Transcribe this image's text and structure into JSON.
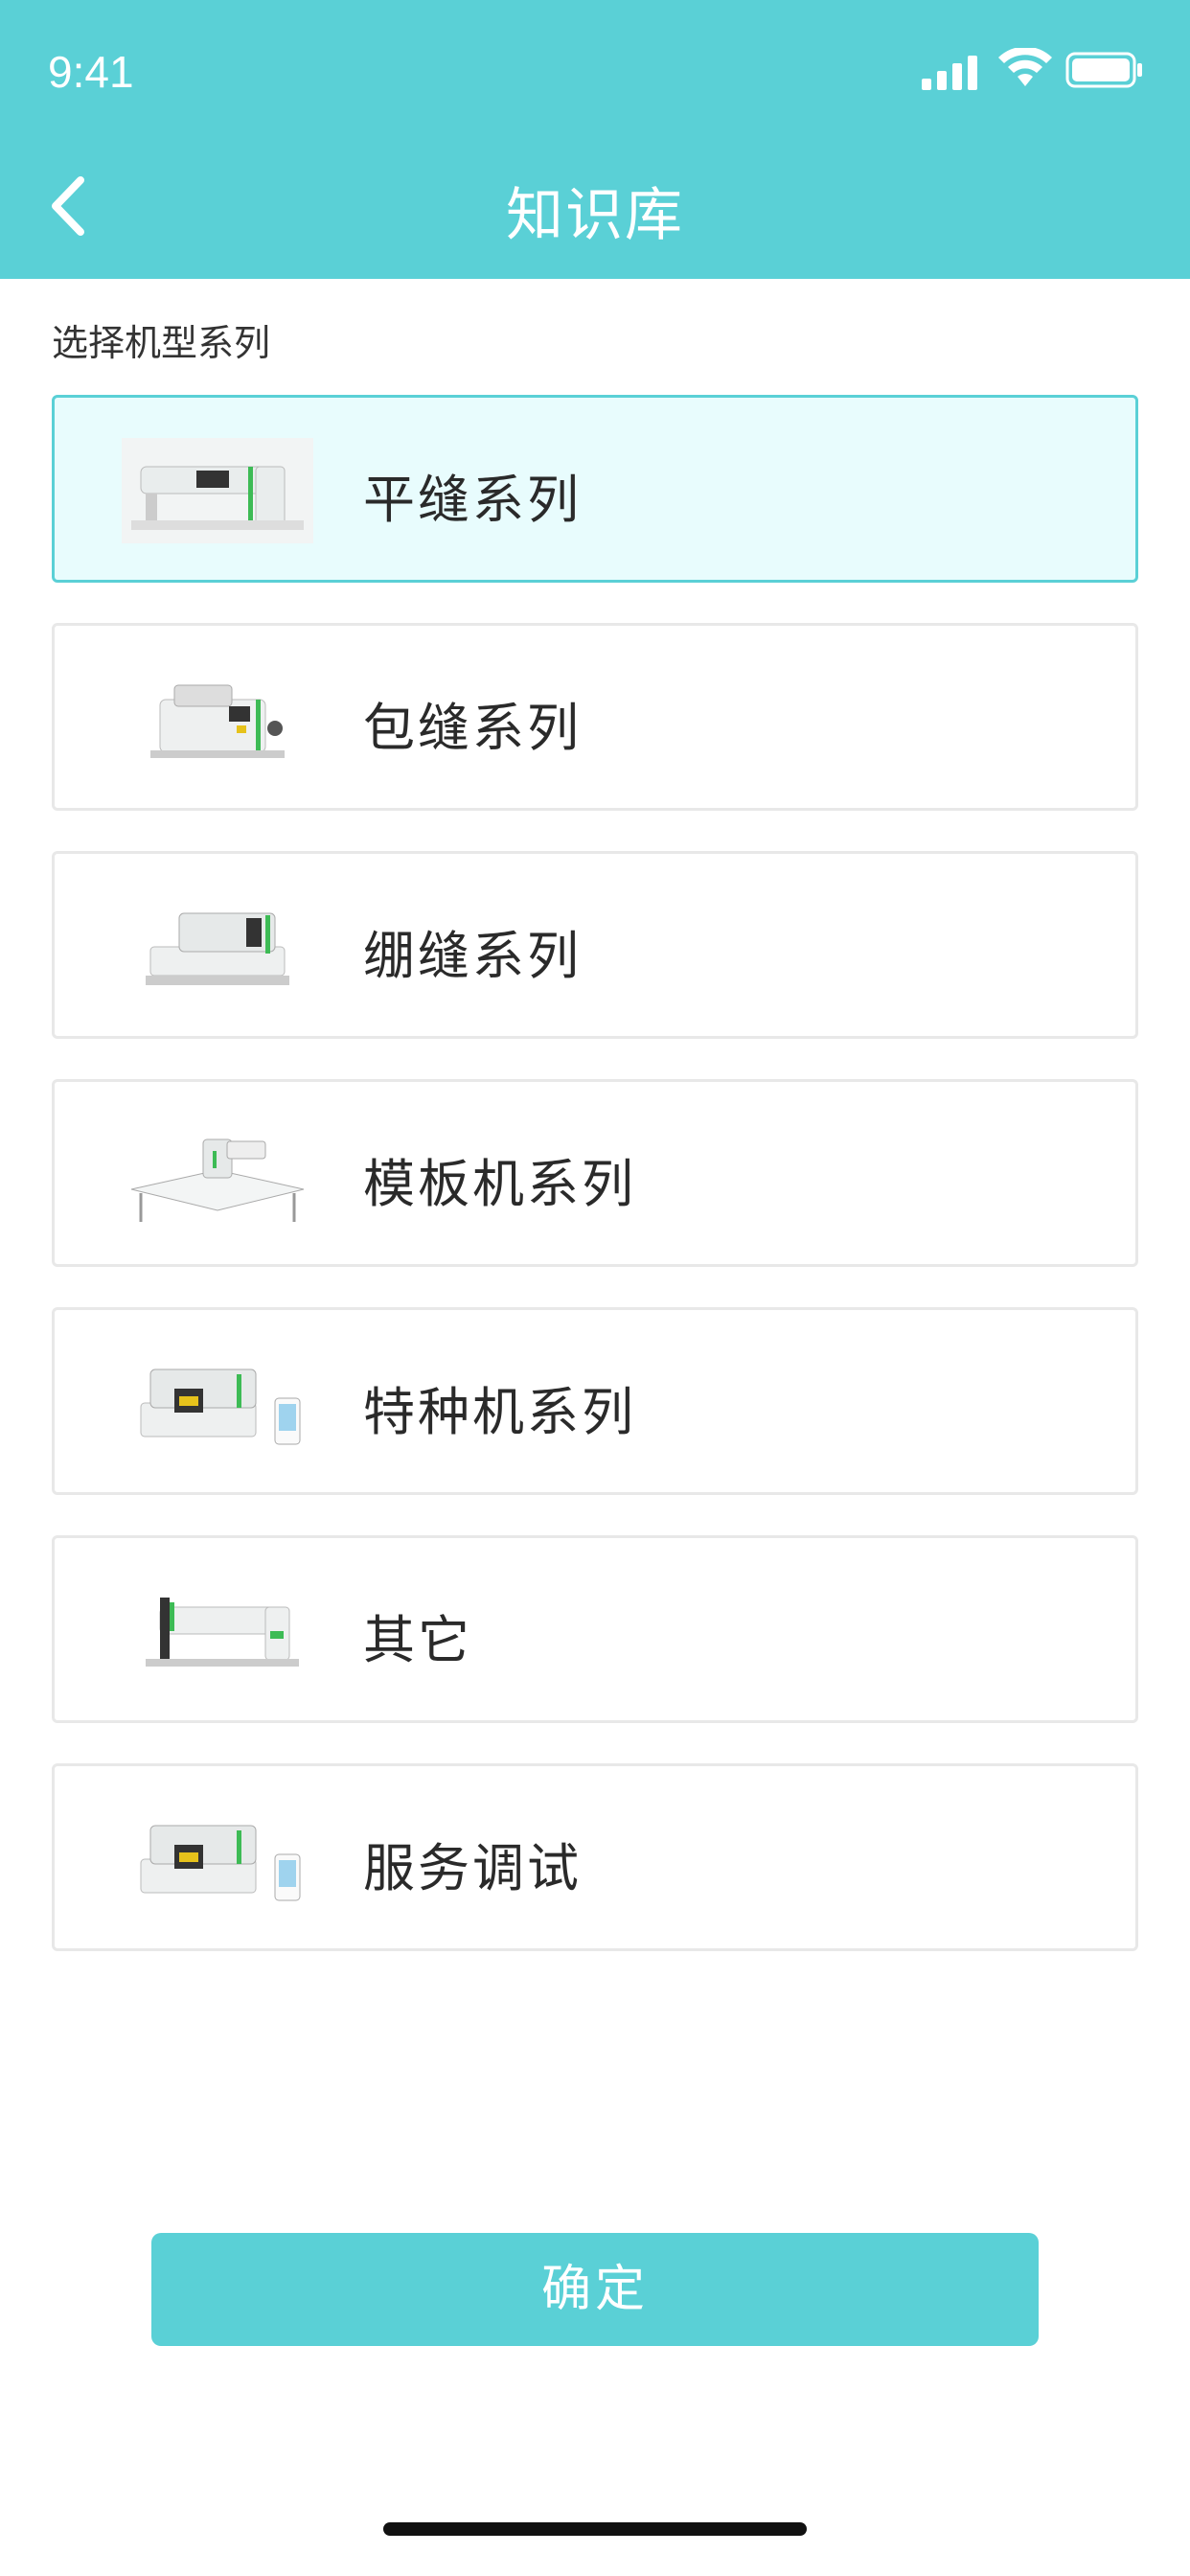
{
  "status_bar": {
    "time": "9:41"
  },
  "header": {
    "title": "知识库",
    "back_icon": "chevron-left-icon"
  },
  "section_label": "选择机型系列",
  "series": [
    {
      "label": "平缝系列",
      "selected": true,
      "thumb": "lockstitch-machine"
    },
    {
      "label": "包缝系列",
      "selected": false,
      "thumb": "overlock-machine"
    },
    {
      "label": "绷缝系列",
      "selected": false,
      "thumb": "coverstitch-machine"
    },
    {
      "label": "模板机系列",
      "selected": false,
      "thumb": "template-machine"
    },
    {
      "label": "特种机系列",
      "selected": false,
      "thumb": "special-machine"
    },
    {
      "label": "其它",
      "selected": false,
      "thumb": "other-machine"
    },
    {
      "label": "服务调试",
      "selected": false,
      "thumb": "service-machine"
    }
  ],
  "confirm_label": "确定",
  "colors": {
    "accent": "#5ad0d6",
    "selected_bg": "#e8fcfd"
  }
}
